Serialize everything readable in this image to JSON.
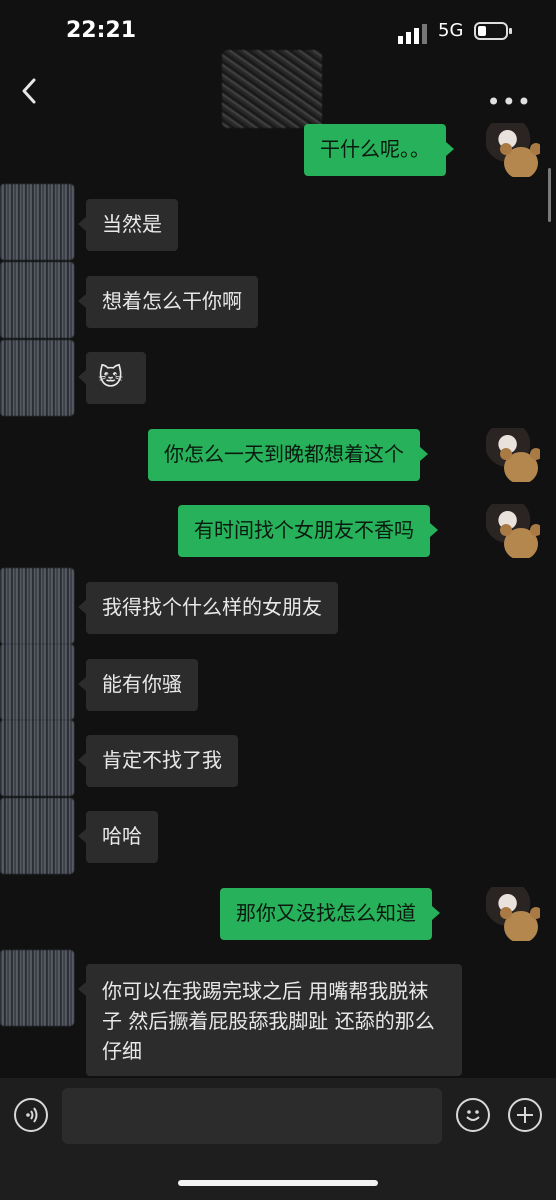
{
  "status": {
    "time": "22:21",
    "network": "5G"
  },
  "nav": {
    "more_label": "•••"
  },
  "messages": [
    {
      "side": "out",
      "text": "干什么呢。。"
    },
    {
      "side": "in",
      "text": "当然是"
    },
    {
      "side": "in",
      "text": "想着怎么干你啊"
    },
    {
      "side": "in",
      "text": "🐱"
    },
    {
      "side": "out",
      "text": "你怎么一天到晚都想着这个"
    },
    {
      "side": "out",
      "text": "有时间找个女朋友不香吗"
    },
    {
      "side": "in",
      "text": "我得找个什么样的女朋友"
    },
    {
      "side": "in",
      "text": "能有你骚"
    },
    {
      "side": "in",
      "text": "肯定不找了我"
    },
    {
      "side": "in",
      "text": "哈哈"
    },
    {
      "side": "out",
      "text": "那你又没找怎么知道"
    },
    {
      "side": "in",
      "text": "你可以在我踢完球之后 用嘴帮我脱袜子 然后撅着屁股舔我脚趾 还舔的那么仔细"
    }
  ],
  "input": {
    "value": "",
    "placeholder": ""
  },
  "icons": {
    "back": "back-arrow-icon",
    "voice": "voice-icon",
    "emoji": "emoji-icon",
    "plus": "plus-icon"
  }
}
